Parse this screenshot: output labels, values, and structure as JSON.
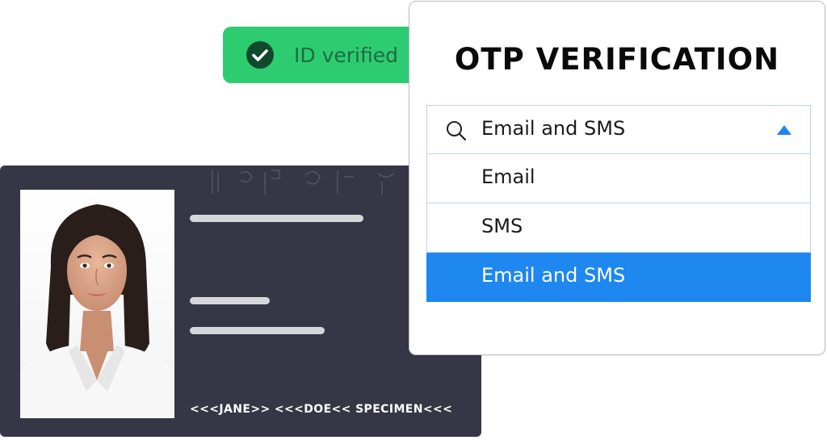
{
  "badge": {
    "label": "ID verified",
    "icon": "check-circle-icon",
    "color": "#2ecc71"
  },
  "otp": {
    "title": "OTP VERIFICATION",
    "dropdown": {
      "search_icon": "search-icon",
      "selected_value": "Email and SMS",
      "caret_icon": "caret-up-icon",
      "options": [
        {
          "label": "Email",
          "selected": false
        },
        {
          "label": "SMS",
          "selected": false
        },
        {
          "label": "Email and SMS",
          "selected": true
        }
      ],
      "highlight_color": "#1e87f0"
    }
  },
  "id_card": {
    "mrz": "<<<JANE>> <<<DOE<< SPECIMEN<<<",
    "background_color": "#363646"
  }
}
